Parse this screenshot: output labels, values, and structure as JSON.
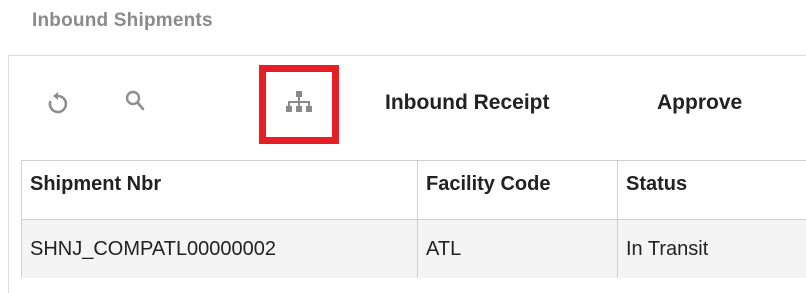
{
  "header": {
    "title": "Inbound Shipments"
  },
  "toolbar": {
    "refresh_icon": "refresh-icon",
    "search_icon": "search-icon",
    "hierarchy_icon": "hierarchy-icon",
    "inbound_receipt_label": "Inbound Receipt",
    "approve_label": "Approve",
    "highlight_color": "#e61e25"
  },
  "grid": {
    "columns": [
      "Shipment Nbr",
      "Facility Code",
      "Status"
    ],
    "rows": [
      {
        "shipment_nbr": "SHNJ_COMPATL00000002",
        "facility_code": "ATL",
        "status": "In Transit"
      }
    ]
  }
}
